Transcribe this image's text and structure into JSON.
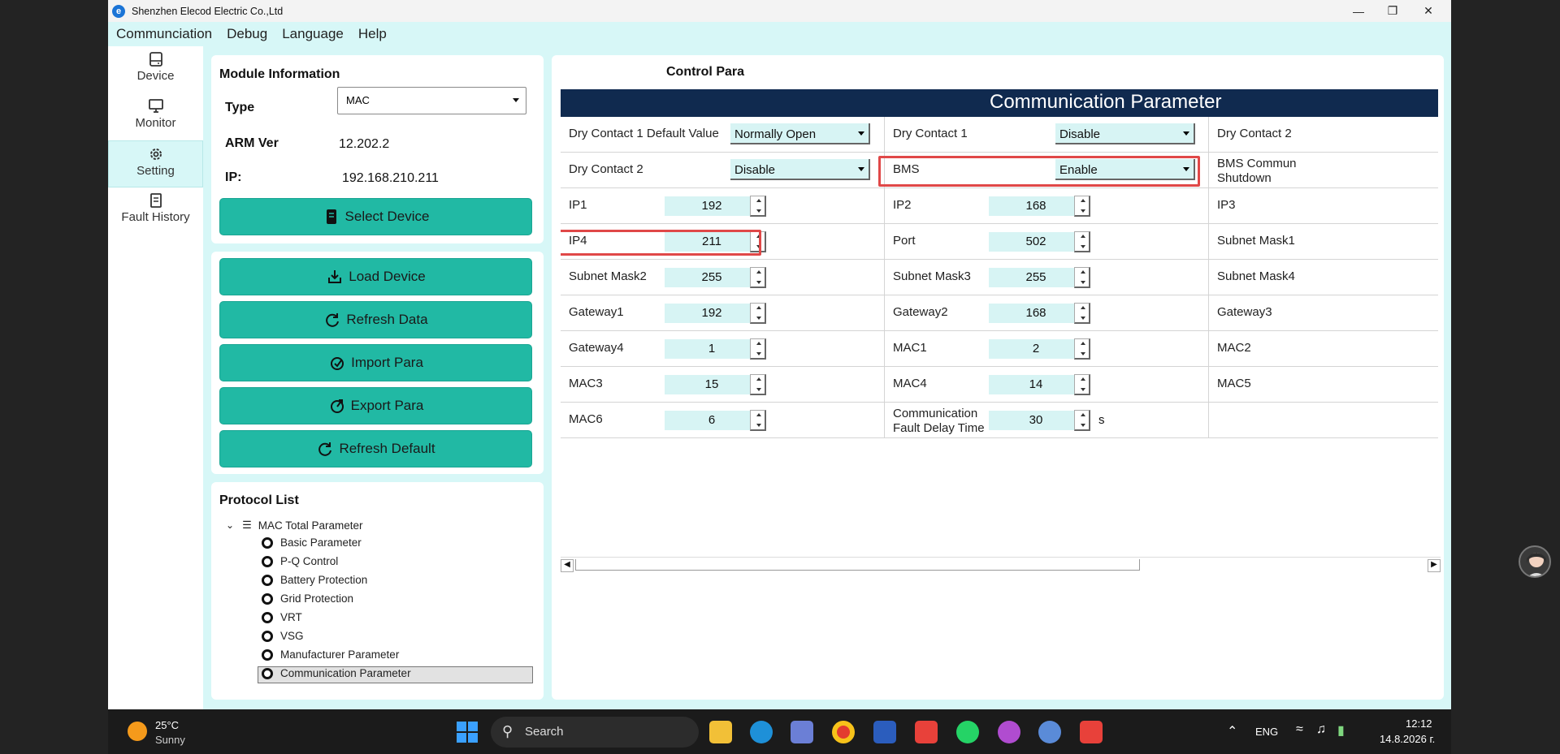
{
  "app": {
    "title": "Shenzhen Elecod Electric Co.,Ltd"
  },
  "menu": [
    "Communciation",
    "Debug",
    "Language",
    "Help"
  ],
  "nav": [
    {
      "label": "Device",
      "icon": "device-icon"
    },
    {
      "label": "Monitor",
      "icon": "monitor-icon"
    },
    {
      "label": "Setting",
      "icon": "gear-icon",
      "active": true
    },
    {
      "label": "Fault History",
      "icon": "history-icon"
    }
  ],
  "module": {
    "title": "Module Information",
    "type_label": "Type",
    "type_value": "MAC",
    "arm_label": "ARM Ver",
    "arm_value": "12.202.2",
    "ip_label": "IP:",
    "ip_value": "192.168.210.211",
    "select_button": "Select Device"
  },
  "actions": {
    "load": "Load Device",
    "refresh": "Refresh Data",
    "import": "Import Para",
    "export": "Export Para",
    "default": "Refresh Default"
  },
  "protocol": {
    "title": "Protocol List",
    "root": "MAC Total Parameter",
    "items": [
      "Basic Parameter",
      "P-Q Control",
      "Battery Protection",
      "Grid Protection",
      "VRT",
      "VSG",
      "Manufacturer Parameter",
      "Communication Parameter"
    ],
    "selected_index": 7
  },
  "control": {
    "title": "Control Para",
    "header": "Communication Parameter",
    "rows": [
      [
        {
          "label": "Dry Contact 1 Default Value",
          "type": "dropdown",
          "value": "Normally Open"
        },
        {
          "label": "Dry Contact 1",
          "type": "dropdown",
          "value": "Disable"
        },
        {
          "label": "Dry Contact 2",
          "type": "text"
        }
      ],
      [
        {
          "label": "Dry Contact 2",
          "type": "dropdown",
          "value": "Disable"
        },
        {
          "label": "BMS",
          "type": "dropdown",
          "value": "Enable",
          "highlight": true
        },
        {
          "label": "BMS Commun\nShutdown",
          "type": "text"
        }
      ],
      [
        {
          "label": "IP1",
          "type": "spin",
          "value": "192"
        },
        {
          "label": "IP2",
          "type": "spin",
          "value": "168"
        },
        {
          "label": "IP3",
          "type": "text"
        }
      ],
      [
        {
          "label": "IP4",
          "type": "spin",
          "value": "211",
          "highlight": true
        },
        {
          "label": "Port",
          "type": "spin",
          "value": "502"
        },
        {
          "label": "Subnet Mask1",
          "type": "text"
        }
      ],
      [
        {
          "label": "Subnet Mask2",
          "type": "spin",
          "value": "255"
        },
        {
          "label": "Subnet Mask3",
          "type": "spin",
          "value": "255"
        },
        {
          "label": "Subnet Mask4",
          "type": "text"
        }
      ],
      [
        {
          "label": "Gateway1",
          "type": "spin",
          "value": "192"
        },
        {
          "label": "Gateway2",
          "type": "spin",
          "value": "168"
        },
        {
          "label": "Gateway3",
          "type": "text"
        }
      ],
      [
        {
          "label": "Gateway4",
          "type": "spin",
          "value": "1"
        },
        {
          "label": "MAC1",
          "type": "spin",
          "value": "2"
        },
        {
          "label": "MAC2",
          "type": "text"
        }
      ],
      [
        {
          "label": "MAC3",
          "type": "spin",
          "value": "15"
        },
        {
          "label": "MAC4",
          "type": "spin",
          "value": "14"
        },
        {
          "label": "MAC5",
          "type": "text"
        }
      ],
      [
        {
          "label": "MAC6",
          "type": "spin",
          "value": "6"
        },
        {
          "label": "Communication\nFault Delay Time",
          "type": "spin",
          "value": "30",
          "unit": "s"
        },
        {
          "label": "",
          "type": "text"
        }
      ]
    ]
  },
  "taskbar": {
    "weather_temp": "25°C",
    "weather_desc": "Sunny",
    "search_placeholder": "Search",
    "lang": "ENG",
    "time": "12:12",
    "date": "14.8.2026 г."
  },
  "colors": {
    "accent": "#21b9a4",
    "header": "#102a4f",
    "highlight": "#e04848",
    "bg": "#d7f7f7"
  }
}
